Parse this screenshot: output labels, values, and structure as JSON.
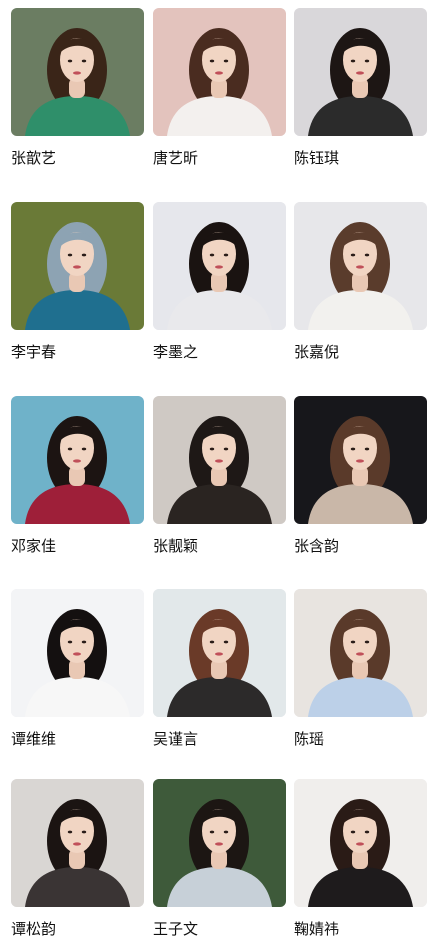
{
  "people": [
    {
      "name": "张歆艺",
      "bg": "#6b7d62",
      "top": "#2f8f6a",
      "hair": "#3a2518"
    },
    {
      "name": "唐艺昕",
      "bg": "#e3c3bd",
      "top": "#f3f0ee",
      "hair": "#4a2c20"
    },
    {
      "name": "陈钰琪",
      "bg": "#d9d7da",
      "top": "#2b2b2b",
      "hair": "#1d1614"
    },
    {
      "name": "李宇春",
      "bg": "#6a7a37",
      "top": "#1f6f8f",
      "hair": "#8da3b3"
    },
    {
      "name": "李墨之",
      "bg": "#e6e7ec",
      "top": "#e9e9ec",
      "hair": "#1a1311"
    },
    {
      "name": "张嘉倪",
      "bg": "#e7e7ea",
      "top": "#f2f1ee",
      "hair": "#5a3c2c"
    },
    {
      "name": "邓家佳",
      "bg": "#6fb2c9",
      "top": "#9e1f39",
      "hair": "#1c1412"
    },
    {
      "name": "张靓颖",
      "bg": "#cfc9c4",
      "top": "#2a2421",
      "hair": "#1e1816"
    },
    {
      "name": "张含韵",
      "bg": "#17171b",
      "top": "#c9b7a8",
      "hair": "#5a3a2a"
    },
    {
      "name": "谭维维",
      "bg": "#f3f4f6",
      "top": "#f7f7f7",
      "hair": "#141010"
    },
    {
      "name": "吴谨言",
      "bg": "#e2e8ea",
      "top": "#2c2a2a",
      "hair": "#6a3a28"
    },
    {
      "name": "陈瑶",
      "bg": "#e8e4e0",
      "top": "#bcd0e8",
      "hair": "#5a3a2a"
    },
    {
      "name": "谭松韵",
      "bg": "#d9d6d3",
      "top": "#3a3434",
      "hair": "#1b1412"
    },
    {
      "name": "王子文",
      "bg": "#3e5a3a",
      "top": "#c7d0d8",
      "hair": "#1c1613"
    },
    {
      "name": "鞠婧祎",
      "bg": "#f0eeec",
      "top": "#1e1b1c",
      "hair": "#2a1b16"
    }
  ]
}
